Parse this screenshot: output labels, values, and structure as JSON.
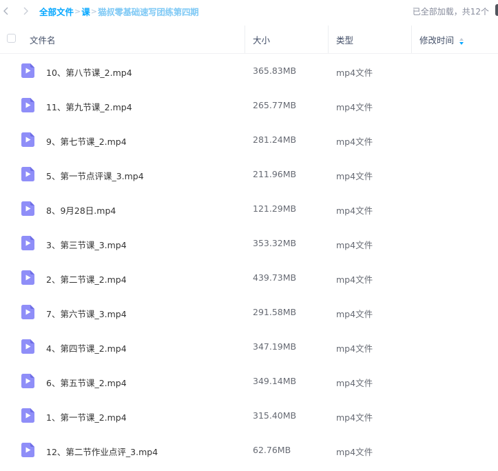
{
  "breadcrumb": {
    "root_label": "全部文件",
    "folder_label": "课",
    "current_label": "猫叔零基础速写团练第四期",
    "separator": ">"
  },
  "status": {
    "load_text": "已全部加载，共12个"
  },
  "table": {
    "columns": {
      "name": "文件名",
      "size": "大小",
      "type": "类型",
      "modified": "修改时间"
    },
    "sort": {
      "column": "modified",
      "direction": "descending"
    },
    "rows": [
      {
        "name": "10、第八节课_2.mp4",
        "size": "365.83MB",
        "type": "mp4文件",
        "modified": ""
      },
      {
        "name": "11、第九节课_2.mp4",
        "size": "265.77MB",
        "type": "mp4文件",
        "modified": ""
      },
      {
        "name": "9、第七节课_2.mp4",
        "size": "281.24MB",
        "type": "mp4文件",
        "modified": ""
      },
      {
        "name": "5、第一节点评课_3.mp4",
        "size": "211.96MB",
        "type": "mp4文件",
        "modified": ""
      },
      {
        "name": "8、9月28日.mp4",
        "size": "121.29MB",
        "type": "mp4文件",
        "modified": ""
      },
      {
        "name": "3、第三节课_3.mp4",
        "size": "353.32MB",
        "type": "mp4文件",
        "modified": ""
      },
      {
        "name": "2、第二节课_2.mp4",
        "size": "439.73MB",
        "type": "mp4文件",
        "modified": ""
      },
      {
        "name": "7、第六节课_3.mp4",
        "size": "291.58MB",
        "type": "mp4文件",
        "modified": ""
      },
      {
        "name": "4、第四节课_2.mp4",
        "size": "347.19MB",
        "type": "mp4文件",
        "modified": ""
      },
      {
        "name": "6、第五节课_2.mp4",
        "size": "349.14MB",
        "type": "mp4文件",
        "modified": ""
      },
      {
        "name": "1、第一节课_2.mp4",
        "size": "315.40MB",
        "type": "mp4文件",
        "modified": ""
      },
      {
        "name": "12、第二节作业点评_3.mp4",
        "size": "62.76MB",
        "type": "mp4文件",
        "modified": ""
      }
    ]
  },
  "icons": {
    "back": "chevron-left-icon",
    "forward": "chevron-right-icon",
    "video_file": "video-file-icon",
    "sort": "sort-icon"
  },
  "colors": {
    "accent": "#06a7ff",
    "breadcrumb_current": "#7fc9f5",
    "video_icon": "#8f8ef8",
    "video_icon_dark": "#6f6ee6",
    "muted_text": "#878c9c"
  }
}
